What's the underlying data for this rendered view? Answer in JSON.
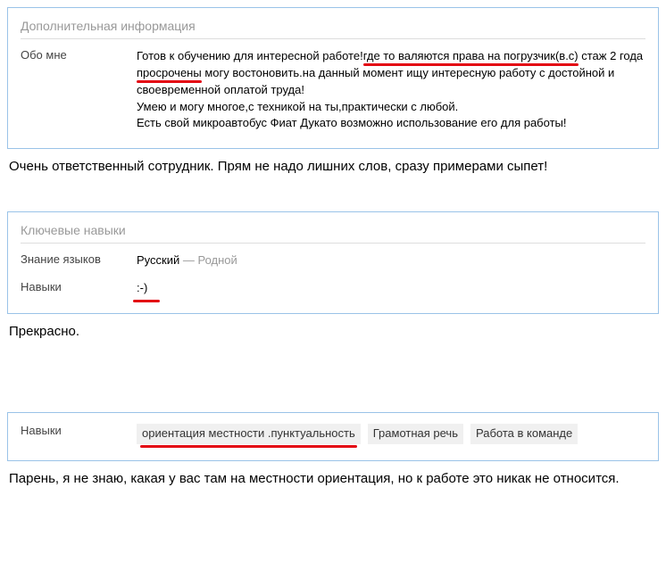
{
  "panel1": {
    "header": "Дополнительная информация",
    "about_label": "Обо мне",
    "about_line1a": "Готов к обучению для интересной работе!",
    "about_line1b": "где то валяются права на погрузчик(в.с)",
    "about_line1c": " стаж 2 года ",
    "about_line1d": "просрочены",
    "about_line1e": " могу востоновить.на данный момент ищу интересную работу с достойной и своевременной оплатой труда!",
    "about_line2": "Умею и могу многое,с техникой на ты,практически с любой.",
    "about_line3": "Есть свой микроавтобус Фиат Дукато возможно использование его для работы!"
  },
  "comment1": "Очень ответственный сотрудник. Прям не надо лишних слов, сразу примерами сыпет!",
  "panel2": {
    "header": "Ключевые навыки",
    "lang_label": "Знание языков",
    "lang_name": "Русский",
    "lang_sep": " — ",
    "lang_level": "Родной",
    "skills_label": "Навыки",
    "skills_value": ":-)"
  },
  "comment2": "Прекрасно.",
  "panel3": {
    "skills_label": "Навыки",
    "tags": [
      "ориентация местности .пунктуальность",
      "Грамотная речь",
      "Работа в команде"
    ]
  },
  "comment3": "Парень, я не знаю, какая у вас там на местности ориентация, но к работе это никак не относится."
}
